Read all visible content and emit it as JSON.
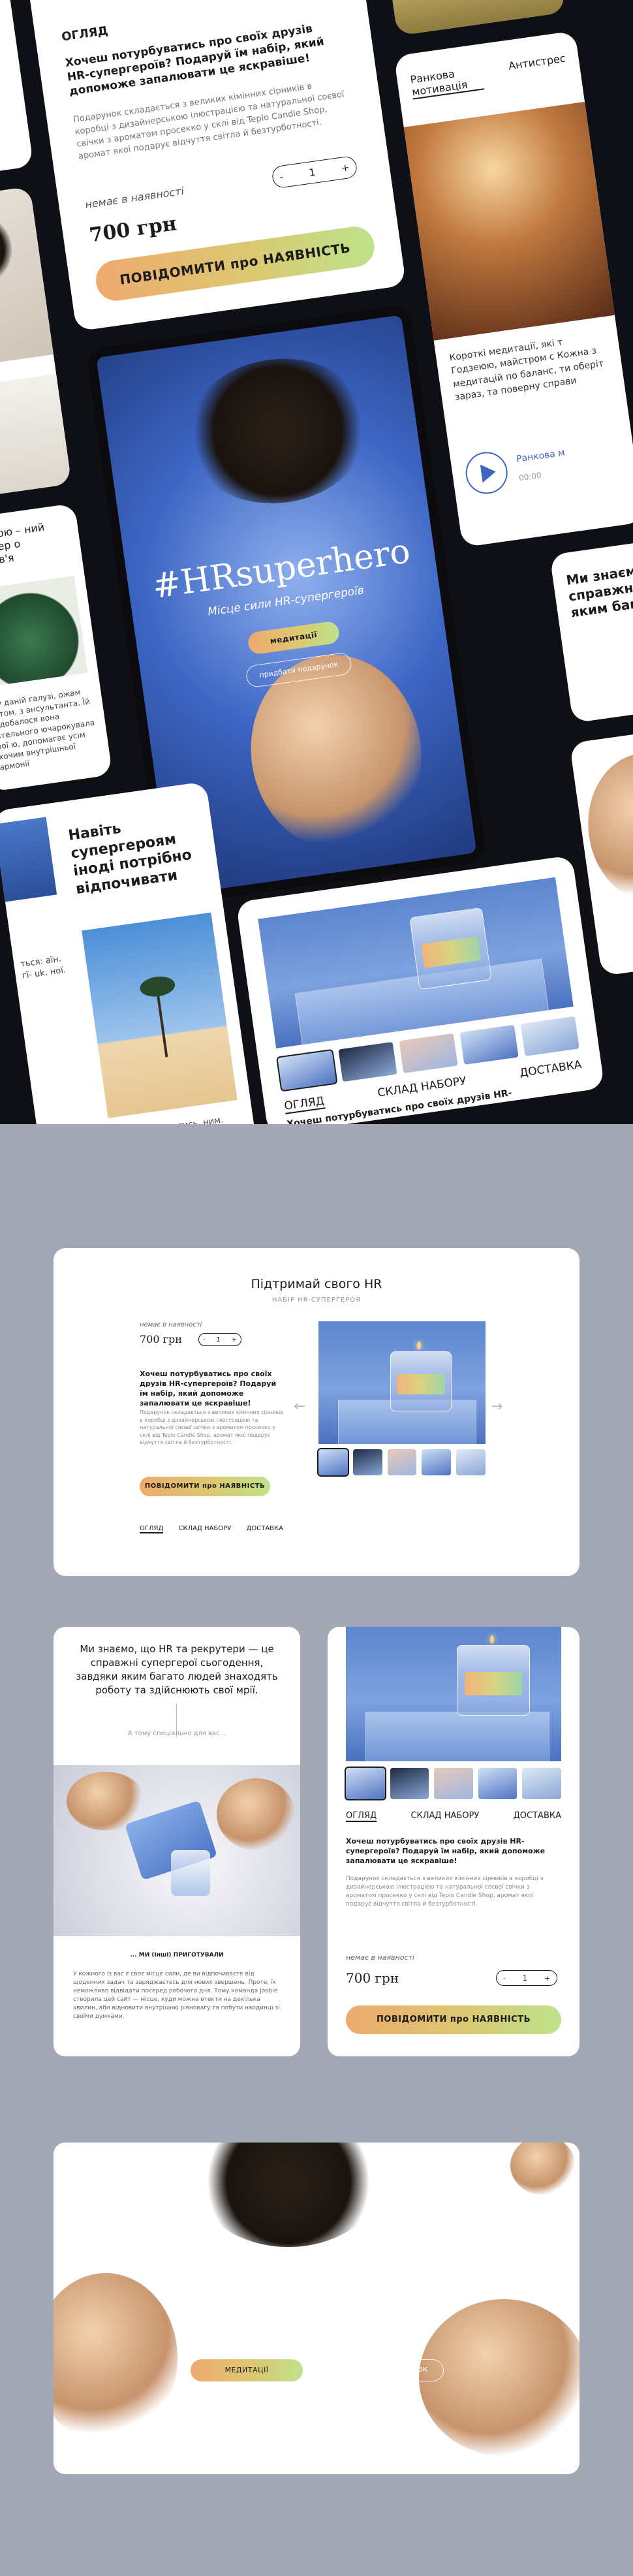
{
  "colors": {
    "background": "#a3a8b4",
    "accent_start": "#eeaa6e",
    "accent_end": "#bde38a",
    "hero_blue": "#3d66c4"
  },
  "tilted_showcase": {
    "product_card": {
      "top_label": "ОГЛЯД",
      "title": "Хочеш потурбуватись про своїх друзів HR-супергероїв? Подаруй їм набір, який допоможе запалювати це яскравіше!",
      "description": "Подарунок складається з великих кімінних сірників в коробці з дизайнерською ілюстрацією та натуральної соєвої свічки з ароматом просекко у склі від Teplo Candle Shop, аромат якої подарує відчуття світла й безтурботності.",
      "availability": "немає в наявності",
      "qty": "1",
      "price": "700 грн",
      "cta": "ПОВІДОМИТИ про НАЯВНІСТЬ"
    },
    "hero_phone": {
      "headline": "#HRsuperhero",
      "subtitle": "Місце сили HR-супергероїв",
      "btn_primary": "медитації",
      "btn_secondary": "придбати подарунок"
    },
    "gallery_phone": {
      "tabs": [
        "ОГЛЯД",
        "СКЛАД НАБОРУ",
        "ДОСТАВКА"
      ],
      "caption": "Хочеш потурбуватись про своїх друзів HR-"
    },
    "meditation_phone": {
      "tabs": [
        "Ранкова мотивація",
        "Антистрес"
      ],
      "text": "Короткі медитації, які т Годзеюю, майстром с Кожна з медитацій по баланс, ти оберіт зараз, та поверну справи",
      "track_name": "Ранкова м",
      "time": "00:00"
    },
    "left_phone": {
      "text": "Годзеюю – ний майстер о здоров'я",
      "text2": "ід у даній галузі, ожам світом, з ансультанта. Їй подобалося вона чительного ючарокувала свої ю, допомагає усім охочим внутрішньої гармонії"
    },
    "quote_phone": {
      "heading": "Навіть супергероям іноді потрібно відпочивати",
      "side_text": "ться: аїн. гї- uk. ної.",
      "bottom_text": "мне здатись, ним."
    },
    "right_phone": {
      "heading": "Ми знаємо, справжні с яким багат"
    }
  },
  "desktop_panel": {
    "title": "Підтримай свого HR",
    "subtitle": "НАБІР HR-СУПЕРГЕРОЯ",
    "availability": "немає в наявності",
    "price": "700 грн",
    "qty": "1",
    "heading": "Хочеш потурбуватись про своїх друзів HR-супергероїв? Подаруй їм набір, який допоможе запалювати це яскравіше!",
    "description": "Подарунок складається з великих кімінних сірників в коробці з дизайнерською ілюстрацією та натуральної соєвої свічки з ароматом просекко у склі від Teplo Candle Shop, аромат якої подарує відчуття світла й безтурботності.",
    "cta": "ПОВІДОМИТИ про НАЯВНІСТЬ",
    "tabs": [
      "ОГЛЯД",
      "СКЛАД НАБОРУ",
      "ДОСТАВКА"
    ],
    "prev_icon": "arrow-left-icon",
    "next_icon": "arrow-right-icon"
  },
  "about_panel": {
    "heading": "Ми знаємо, що HR та рекрутери — це справжні супергерої сьогодення, завдяки яким багато людей знаходять роботу та здійснюють свої мрії.",
    "sub": "А тому спеціально для вас...",
    "we_prepared": "... МИ (інші) ПРИГОТУВАЛИ",
    "body": "У кожного із вас є своє місце сили, де ви відпочиваєте від щоденних задач та заряджаєтесь для нових звершень. Проте, їх неможливо відвідати посеред робочого дня. Тому команда Joobie створила цей сайт — місце, куди можна втекти на декілька хвилин, аби відновити внутрішню рівновагу та побути наодинці зі своїми думками."
  },
  "mobile_product": {
    "tabs": [
      "ОГЛЯД",
      "СКЛАД НАБОРУ",
      "ДОСТАВКА"
    ],
    "heading": "Хочеш потурбуватись про своїх друзів HR-супергероїв? Подаруй їм набір, який допоможе запалювати це яскравіше!",
    "description": "Подарунок складається з великих кімінних сірників в коробці з дизайнерською ілюстрацією та натуральної соєвої свічки з ароматом просекко у склі від Teplo Candle Shop, аромат якої подарує відчуття світла й безтурботності.",
    "availability": "немає в наявності",
    "price": "700 грн",
    "qty": "1",
    "cta": "ПОВІДОМИТИ про НАЯВНІСТЬ"
  },
  "hero_banner": {
    "headline": "#HRsuperhero",
    "subtitle_pre": "Місце ",
    "subtitle_em": "сили",
    "subtitle_post": " HR-супергероїв",
    "btn_primary": "МЕДИТАЦІЇ",
    "btn_secondary": "ПРИДБАТИ ПОДАРУНОК"
  }
}
